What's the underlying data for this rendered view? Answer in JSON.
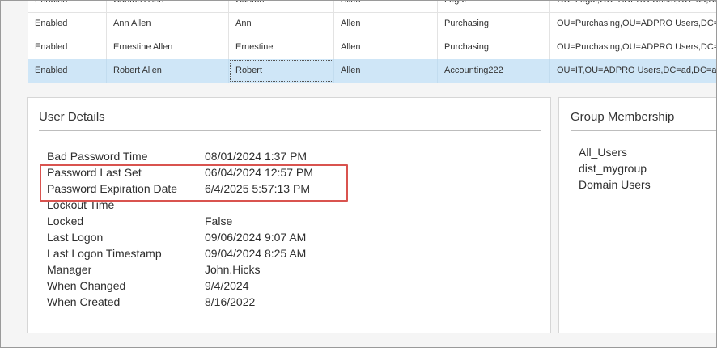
{
  "grid": {
    "rows": [
      {
        "status": "Enabled",
        "display_name": "Canton Allen",
        "first_name": "Canton",
        "last_name": "Allen",
        "department": "Legal",
        "ou": "OU=Legal,OU=ADPRO Users,DC=ad,DC=a"
      },
      {
        "status": "Enabled",
        "display_name": "Ann Allen",
        "first_name": "Ann",
        "last_name": "Allen",
        "department": "Purchasing",
        "ou": "OU=Purchasing,OU=ADPRO Users,DC=a"
      },
      {
        "status": "Enabled",
        "display_name": "Ernestine Allen",
        "first_name": "Ernestine",
        "last_name": "Allen",
        "department": "Purchasing",
        "ou": "OU=Purchasing,OU=ADPRO Users,DC=a"
      },
      {
        "status": "Enabled",
        "display_name": "Robert Allen",
        "first_name": "Robert",
        "last_name": "Allen",
        "department": "Accounting222",
        "ou": "OU=IT,OU=ADPRO Users,DC=ad,DC=a"
      }
    ],
    "selected_row_index": 3
  },
  "user_details": {
    "title": "User Details",
    "rows": [
      {
        "label": "Bad Password Time",
        "value": "08/01/2024 1:37 PM"
      },
      {
        "label": "Password Last Set",
        "value": "06/04/2024 12:57 PM"
      },
      {
        "label": "Password Expiration Date",
        "value": "6/4/2025 5:57:13 PM"
      },
      {
        "label": "Lockout Time",
        "value": ""
      },
      {
        "label": "Locked",
        "value": "False"
      },
      {
        "label": "Last Logon",
        "value": "09/06/2024 9:07 AM"
      },
      {
        "label": "Last Logon Timestamp",
        "value": "09/04/2024 8:25 AM"
      },
      {
        "label": "Manager",
        "value": "John.Hicks"
      },
      {
        "label": "When Changed",
        "value": "9/4/2024"
      },
      {
        "label": "When Created",
        "value": "8/16/2022"
      }
    ]
  },
  "group_membership": {
    "title": "Group Membership",
    "items": [
      "All_Users",
      "dist_mygroup",
      "Domain Users"
    ]
  },
  "colors": {
    "selection": "#cfe6f7",
    "annotation_border": "#d9534f"
  }
}
